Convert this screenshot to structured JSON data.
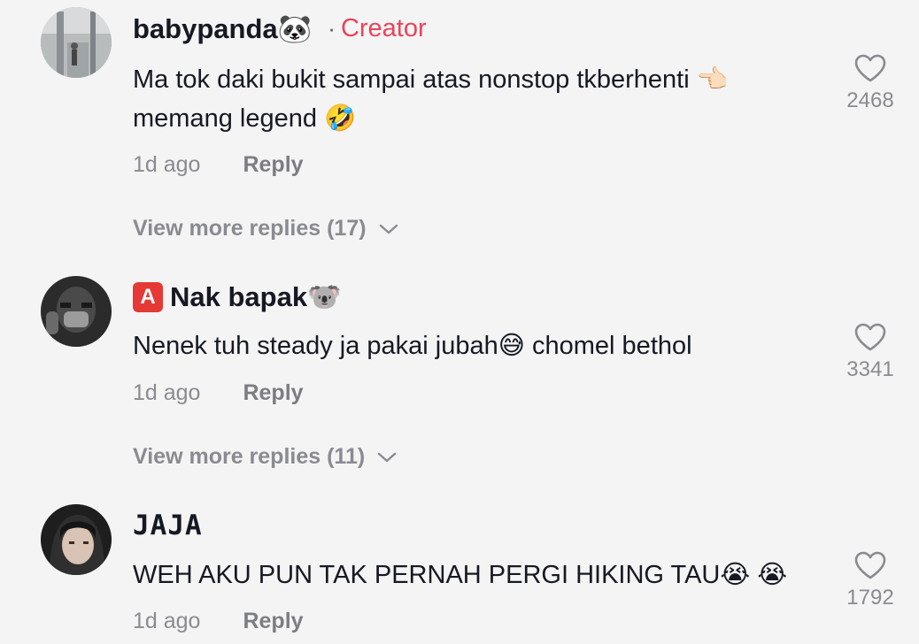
{
  "comments": [
    {
      "username": "babypanda",
      "name_emoji": "🐼",
      "creator_badge": "Creator",
      "creator_sep": "·",
      "text_line1": "Ma tok daki bukit sampai atas nonstop tkberhenti 👈🏻",
      "text_line2": "memang legend 🤣",
      "time": "1d ago",
      "reply": "Reply",
      "likes": "2468",
      "more_replies": "View more replies (17)"
    },
    {
      "badge": "A",
      "username": "Nak bapak",
      "name_emoji": "🐨",
      "text_line1": "Nenek tuh steady ja pakai jubah😅 chomel bethol",
      "time": "1d ago",
      "reply": "Reply",
      "likes": "3341",
      "more_replies": "View more replies (11)"
    },
    {
      "username": "JAJA",
      "text_line1": "WEH AKU PUN TAK PERNAH PERGI HIKING TAU😭 😭",
      "time": "1d ago",
      "reply": "Reply",
      "likes": "1792"
    }
  ]
}
